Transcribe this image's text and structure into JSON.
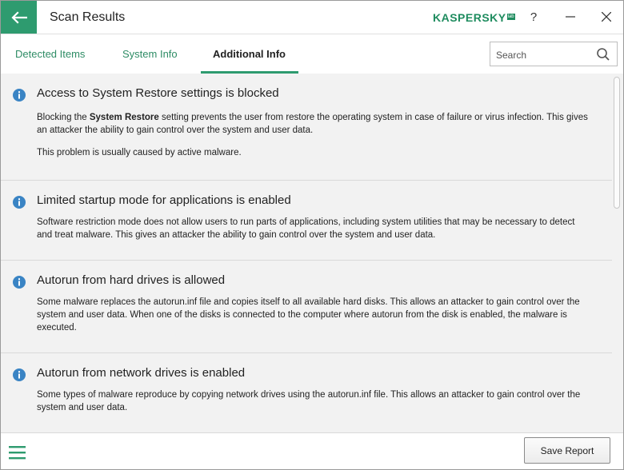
{
  "window": {
    "title": "Scan Results"
  },
  "brand": {
    "logo_text": "KASPERSKY",
    "logo_badge": "lab"
  },
  "titlebar": {
    "help_label": "?",
    "minimize_label": "—",
    "close_label": "✕"
  },
  "tabs": [
    {
      "label": "Detected Items",
      "active": false
    },
    {
      "label": "System Info",
      "active": false
    },
    {
      "label": "Additional Info",
      "active": true
    }
  ],
  "search": {
    "placeholder": "Search",
    "value": ""
  },
  "items": [
    {
      "title": "Access to System Restore settings is blocked",
      "desc_pre": "Blocking the ",
      "desc_bold": "System Restore",
      "desc_post": " setting prevents the user from restore the operating system in case of failure or virus infection. This gives an attacker the ability to gain control over the system and user data.",
      "desc_extra": "This problem is usually caused by active malware."
    },
    {
      "title": "Limited startup mode for applications is enabled",
      "desc": "Software restriction mode does not allow users to run parts of applications, including system utilities that may be necessary to detect and treat malware. This gives an attacker the ability to gain control over the system and user data."
    },
    {
      "title": "Autorun from hard drives is allowed",
      "desc": "Some malware replaces the autorun.inf file and copies itself to all available hard disks. This allows an attacker to gain control over the system and user data. When one of the disks is connected to the computer where autorun from the disk is enabled, the malware is executed."
    },
    {
      "title": "Autorun from network drives is enabled",
      "desc": "Some types of malware reproduce by copying network drives using the autorun.inf file. This allows an attacker to gain control over the system and user data."
    }
  ],
  "footer": {
    "save_label": "Save Report"
  },
  "colors": {
    "accent": "#2e9b6f",
    "info_icon": "#3a84c4",
    "content_bg": "#f2f2f2"
  },
  "icons": {
    "back": "arrow-left-icon",
    "info": "info-icon",
    "search": "search-icon",
    "menu": "hamburger-menu-icon"
  }
}
